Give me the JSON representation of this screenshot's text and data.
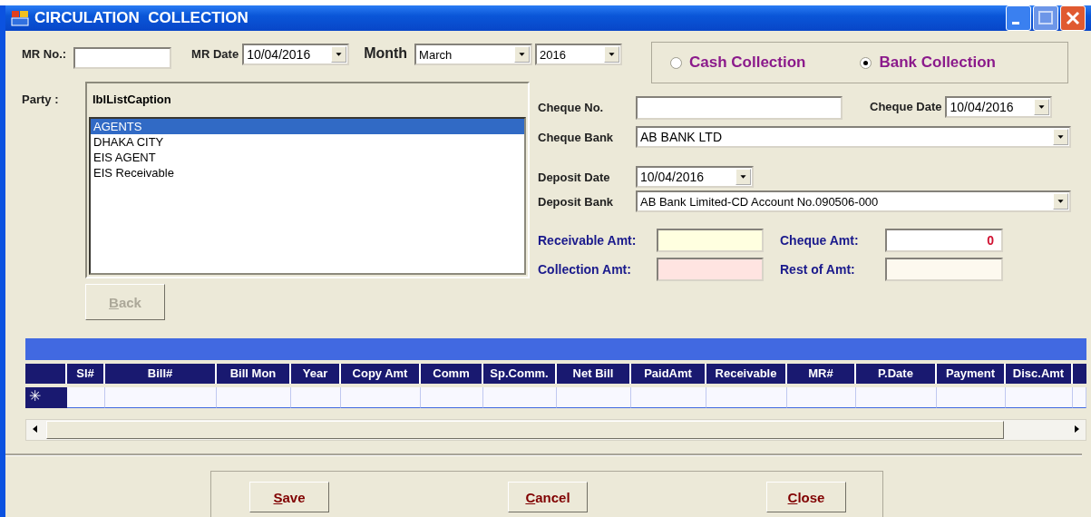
{
  "window": {
    "title": "CIRCULATION  COLLECTION"
  },
  "mr_no": {
    "label": "MR No.:"
  },
  "mr_date": {
    "label": "MR Date",
    "value": "10/04/2016"
  },
  "month": {
    "label": "Month",
    "value": "March"
  },
  "year": {
    "value": "2016"
  },
  "collection_type": [
    {
      "label": "Cash Collection",
      "selected": false
    },
    {
      "label": "Bank Collection",
      "selected": true
    }
  ],
  "party": {
    "label": "Party :",
    "caption": "lblListCaption",
    "items": [
      {
        "label": "AGENTS",
        "selected": true
      },
      {
        "label": "DHAKA CITY",
        "selected": false
      },
      {
        "label": "EIS AGENT",
        "selected": false
      },
      {
        "label": "EIS Receivable",
        "selected": false
      }
    ]
  },
  "back_button": {
    "label": "Back",
    "disabled": true
  },
  "cheque_no": {
    "label": "Cheque No."
  },
  "cheque_date": {
    "label": "Cheque Date",
    "value": "10/04/2016"
  },
  "cheque_bank": {
    "label": "Cheque Bank",
    "value": "AB BANK LTD"
  },
  "deposit_date": {
    "label": "Deposit Date",
    "value": "10/04/2016"
  },
  "deposit_bank": {
    "label": "Deposit Bank",
    "value": "AB Bank Limited-CD Account No.090506-000"
  },
  "amounts": [
    {
      "label": "Receivable Amt:",
      "color": "#ffffe0"
    },
    {
      "label": "Cheque Amt:",
      "value": "0",
      "color": "#ffffff"
    },
    {
      "label": "Collection Amt:",
      "color": "#ffe4e1"
    },
    {
      "label": "Rest of Amt:",
      "color": "#fdf9ef"
    }
  ],
  "grid": {
    "columns": [
      "Sl#",
      "Bill#",
      "Bill Mon",
      "Year",
      "Copy Amt",
      "Comm",
      "Sp.Comm.",
      "Net Bill",
      "PaidAmt",
      "Receivable",
      "MR#",
      "P.Date",
      "Payment",
      "Disc.Amt"
    ],
    "new_row_marker": "✳"
  },
  "buttons": [
    {
      "label": "Save"
    },
    {
      "label": "Cancel"
    },
    {
      "label": "Close"
    }
  ]
}
